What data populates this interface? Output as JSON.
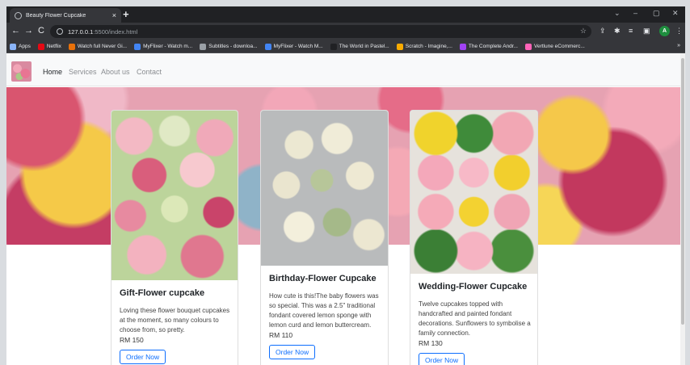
{
  "browser": {
    "tab_title": "Beauty Flower Cupcake",
    "tab_close": "×",
    "new_tab": "+",
    "url_host": "127.0.0.1",
    "url_rest": ":5500/index.html",
    "nav_back": "←",
    "nav_forward": "→",
    "nav_reload": "C",
    "profile_initial": "A",
    "win_min": "–",
    "win_max": "▢",
    "win_close": "✕",
    "win_chevron": "⌄",
    "bookmarks_more": "»",
    "bookmarks": [
      {
        "label": "Apps",
        "color": "#8ab4f8"
      },
      {
        "label": "Netflix",
        "color": "#e50914"
      },
      {
        "label": "Watch full Never Gi...",
        "color": "#e8710a"
      },
      {
        "label": "MyFlixer - Watch m...",
        "color": "#4285f4"
      },
      {
        "label": "Subtitles - downloa...",
        "color": "#9aa0a6"
      },
      {
        "label": "MyFlixer - Watch M...",
        "color": "#4285f4"
      },
      {
        "label": "The World in Pastel...",
        "color": "#202124"
      },
      {
        "label": "Scratch - Imagine,...",
        "color": "#f9ab00"
      },
      {
        "label": "The Complete Andr...",
        "color": "#a142f4"
      },
      {
        "label": "Vertlune eCommerc...",
        "color": "#ff63b8"
      }
    ]
  },
  "navbar": {
    "links": [
      "Home",
      "Services",
      "About us",
      "Contact"
    ]
  },
  "cards": [
    {
      "title": "Gift-Flower cupcake",
      "text": "Loving these flower bouquet cupcakes at the moment, so many colours to choose from, so pretty.",
      "price": "RM 150",
      "button": "Order Now"
    },
    {
      "title": "Birthday-Flower Cupcake",
      "text": "How cute is this!The baby flowers was so special. This was a 2.5\" traditional fondant covered lemon sponge with lemon curd and lemon buttercream.",
      "price": "RM 110",
      "button": "Order Now"
    },
    {
      "title": "Wedding-Flower Cupcake",
      "text": "Twelve cupcakes topped with handcrafted and painted fondant decorations. Sunflowers to symbolise a family connection.",
      "price": "RM 130",
      "button": "Order Now"
    }
  ]
}
